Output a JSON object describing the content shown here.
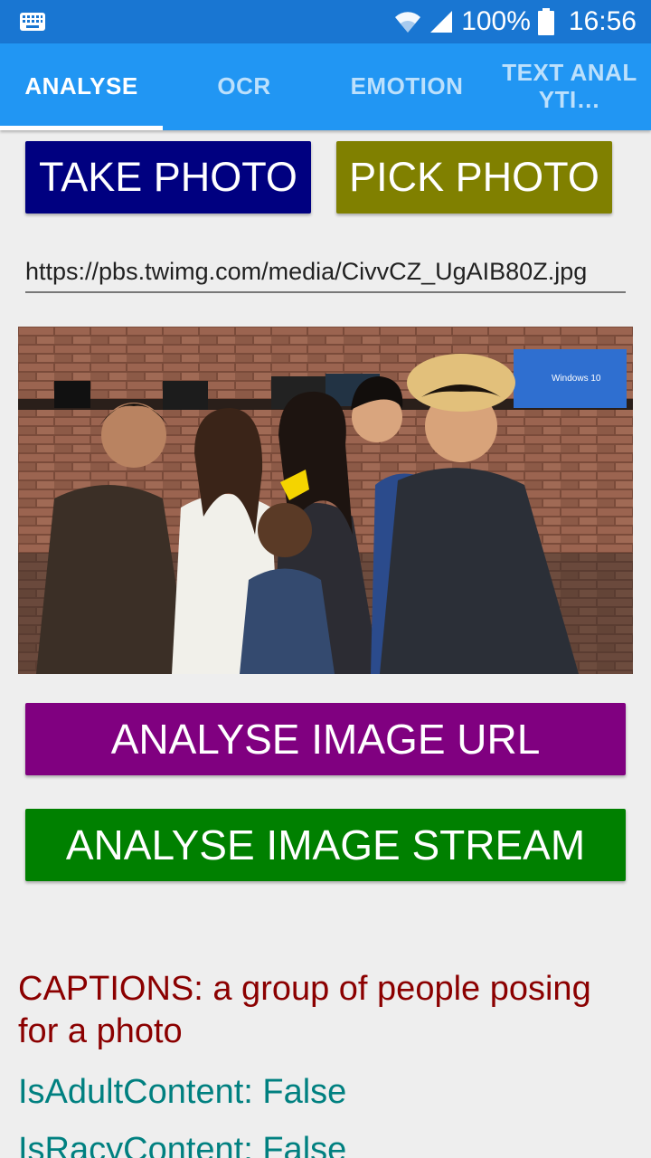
{
  "status_bar": {
    "battery": "100%",
    "time": "16:56",
    "icons": [
      "keyboard-icon",
      "wifi-icon",
      "signal-icon",
      "battery-icon"
    ]
  },
  "tabs": [
    {
      "label": "ANALYSE",
      "active": true
    },
    {
      "label": "OCR",
      "active": false
    },
    {
      "label": "EMOTION",
      "active": false
    },
    {
      "label": "TEXT ANALYTI…",
      "active": false
    }
  ],
  "buttons": {
    "take_photo": "TAKE PHOTO",
    "pick_photo": "PICK PHOTO",
    "analyse_url": "ANALYSE IMAGE URL",
    "analyse_stream": "ANALYSE IMAGE STREAM"
  },
  "url_input": {
    "value": "https://pbs.twimg.com/media/CivvCZ_UgAIB80Z.jpg"
  },
  "photo": {
    "sign_text": "Windows 10"
  },
  "results": {
    "captions": "CAPTIONS: a group of people posing for a photo",
    "is_adult": "IsAdultContent: False",
    "is_racy": "IsRacyContent: False"
  },
  "colors": {
    "status_bar": "#1976D2",
    "tab_bar": "#2196F3",
    "take_photo": "#000080",
    "pick_photo": "#808000",
    "analyse_url": "#800080",
    "analyse_stream": "#008000",
    "captions_text": "#8B0000",
    "flags_text": "#008080"
  }
}
